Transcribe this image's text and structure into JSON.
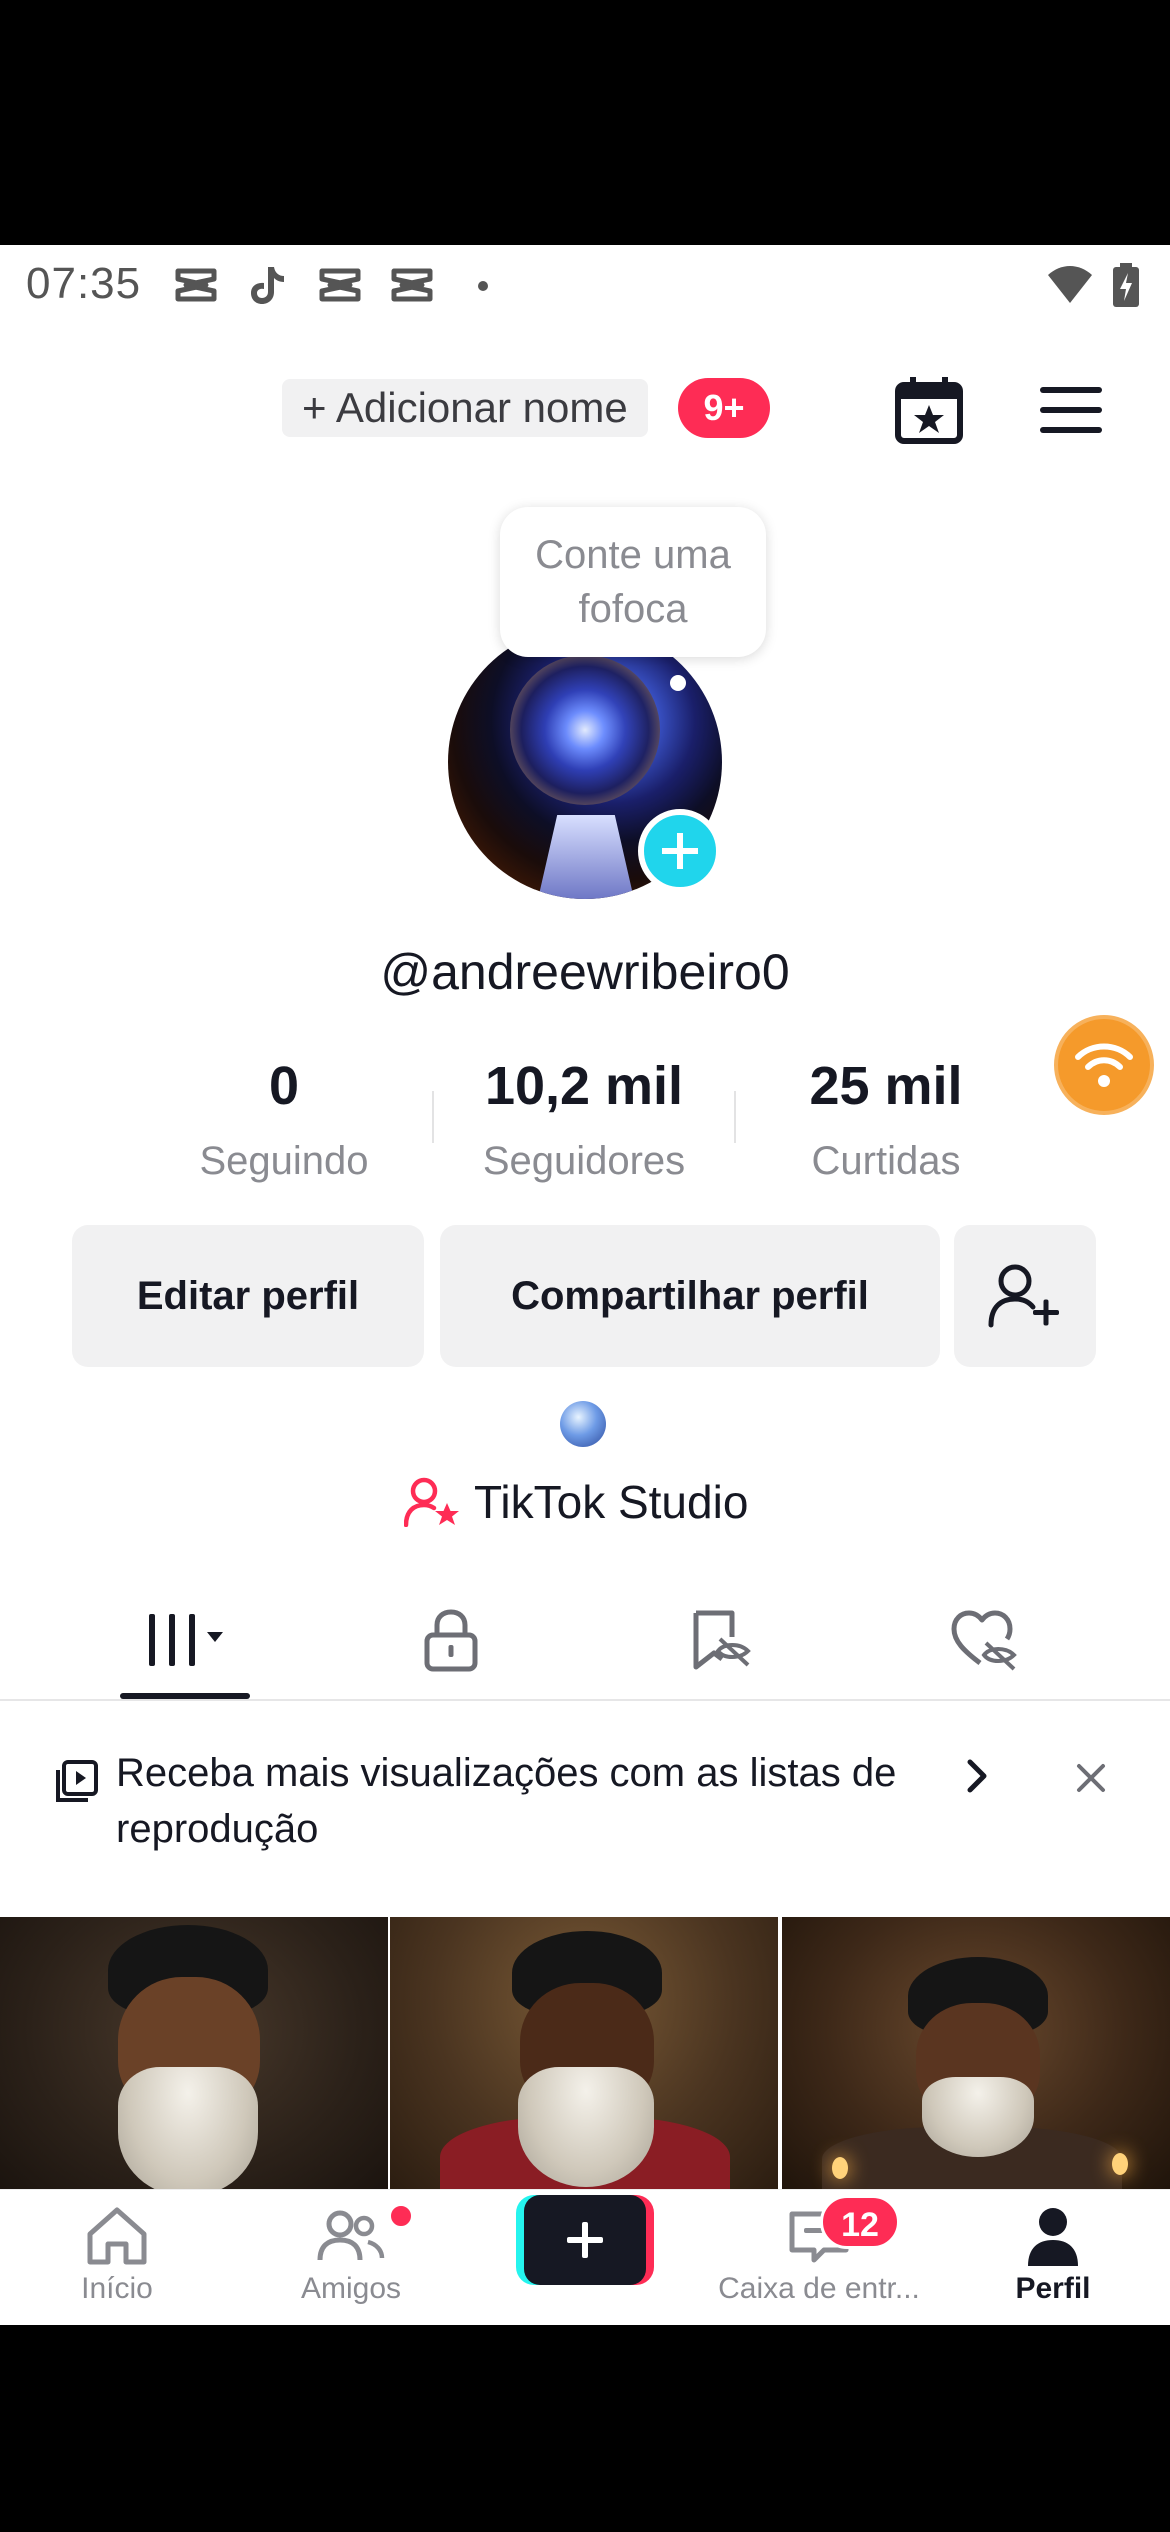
{
  "status_bar": {
    "time": "07:35",
    "icons": [
      "capcut-icon",
      "tiktok-icon",
      "capcut-icon",
      "capcut-icon",
      "dot-icon",
      "wifi-icon",
      "battery-icon"
    ]
  },
  "header": {
    "add_name_label": "+ Adicionar nome",
    "notifications_badge": "9+"
  },
  "profile": {
    "bubble_text": "Conte uma fofoca",
    "username": "@andreewribeiro0",
    "stats": [
      {
        "value": "0",
        "label": "Seguindo"
      },
      {
        "value": "10,2 mil",
        "label": "Seguidores"
      },
      {
        "value": "25 mil",
        "label": "Curtidas"
      }
    ]
  },
  "actions": {
    "edit": "Editar perfil",
    "share": "Compartilhar perfil"
  },
  "studio": {
    "label": "TikTok Studio"
  },
  "tabs": [
    "videos-grid-icon",
    "lock-icon",
    "saved-hidden-icon",
    "liked-hidden-icon"
  ],
  "promo": {
    "text": "Receba mais visualizações com as listas de reprodução"
  },
  "bottom_nav": {
    "items": [
      {
        "label": "Início",
        "icon": "home-icon"
      },
      {
        "label": "Amigos",
        "icon": "friends-icon"
      },
      {
        "label": "",
        "icon": "create-icon"
      },
      {
        "label": "Caixa de entr...",
        "icon": "inbox-icon"
      },
      {
        "label": "Perfil",
        "icon": "profile-icon"
      }
    ],
    "inbox_badge": "12"
  },
  "colors": {
    "accent_red": "#fe2c55",
    "accent_cyan": "#25f4ee",
    "avatar_plus": "#20d5ec",
    "float_button": "#f59a2b"
  }
}
